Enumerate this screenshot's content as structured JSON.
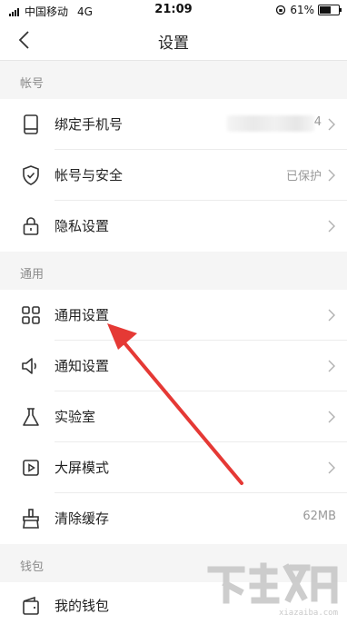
{
  "status_bar": {
    "carrier": "中国移动",
    "network": "4G",
    "time": "21:09",
    "battery_percent": "61%",
    "battery_level": 0.61
  },
  "nav": {
    "title": "设置"
  },
  "sections": {
    "account": {
      "header": "帐号",
      "bind_phone": {
        "label": "绑定手机号",
        "value": "4"
      },
      "security": {
        "label": "帐号与安全",
        "value": "已保护"
      },
      "privacy": {
        "label": "隐私设置"
      }
    },
    "general": {
      "header": "通用",
      "general_settings": {
        "label": "通用设置"
      },
      "notifications": {
        "label": "通知设置"
      },
      "lab": {
        "label": "实验室"
      },
      "big_screen": {
        "label": "大屏模式"
      },
      "clear_cache": {
        "label": "清除缓存",
        "value": "62MB"
      }
    },
    "wallet": {
      "header": "钱包",
      "my_wallet": {
        "label": "我的钱包"
      }
    }
  },
  "colors": {
    "annotation_arrow": "#e53935",
    "accent": "#222222"
  }
}
